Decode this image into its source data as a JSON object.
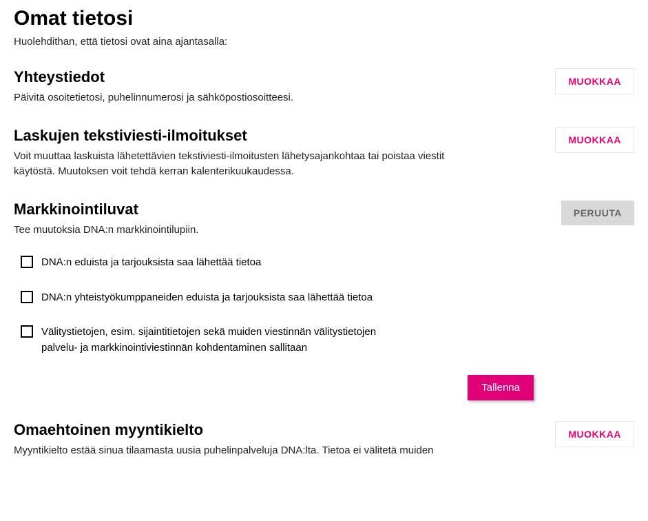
{
  "page": {
    "title": "Omat tietosi",
    "subtitle": "Huolehdithan, että tietosi ovat aina ajantasalla:"
  },
  "buttons": {
    "edit": "MUOKKAA",
    "cancel": "PERUUTA",
    "save": "Tallenna"
  },
  "sections": {
    "contact": {
      "title": "Yhteystiedot",
      "desc": "Päivitä osoitetietosi, puhelinnumerosi ja sähköpostiosoitteesi."
    },
    "sms": {
      "title": "Laskujen tekstiviesti-ilmoitukset",
      "desc": "Voit muuttaa laskuista lähetettävien tekstiviesti-ilmoitusten lähetysajankohtaa tai poistaa viestit käytöstä. Muutoksen voit tehdä kerran kalenterikuukaudessa."
    },
    "marketing": {
      "title": "Markkinointiluvat",
      "desc": "Tee muutoksia DNA:n markkinointilupiin.",
      "checkboxes": [
        "DNA:n eduista ja tarjouksista saa lähettää tietoa",
        "DNA:n yhteistyökumppaneiden eduista ja tarjouksista saa lähettää tietoa",
        "Välitystietojen, esim. sijaintitietojen sekä muiden viestinnän välitystietojen palvelu- ja markkinointiviestinnän kohdentaminen sallitaan"
      ]
    },
    "salesban": {
      "title": "Omaehtoinen myyntikielto",
      "desc": "Myyntikielto estää sinua tilaamasta uusia puhelinpalveluja DNA:lta. Tietoa ei välitetä muiden"
    }
  }
}
